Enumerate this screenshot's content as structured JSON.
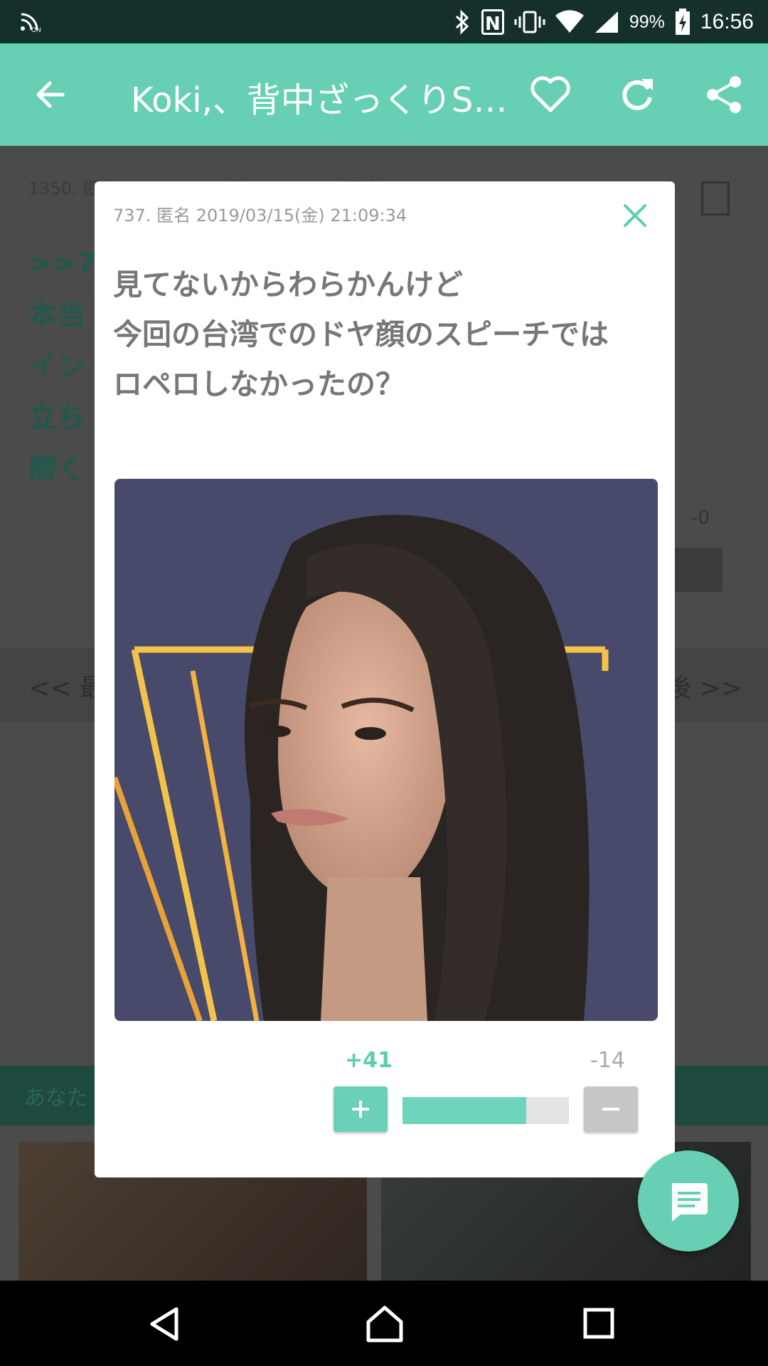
{
  "status_bar": {
    "nfc_label": "N",
    "battery_percent": "99%",
    "time": "16:56",
    "icons": [
      "wifi-calling-icon",
      "bluetooth-icon",
      "nfc-icon",
      "vibrate-icon",
      "wifi-icon",
      "signal-icon",
      "battery-icon"
    ]
  },
  "app_bar": {
    "title": "Koki,、背中ざっくりS…",
    "icons": [
      "back-arrow-icon",
      "heart-icon",
      "refresh-icon",
      "share-icon"
    ]
  },
  "background": {
    "meta": "1350. 匿名 2019/03/16(土) 00:00:00 (返信)",
    "lines": [
      ">>737",
      "本当",
      "イン",
      "立ち",
      "磨く"
    ],
    "minus_count": "-0",
    "nav_first": "<<  最",
    "nav_last": "後  >>",
    "banner": "あなた"
  },
  "modal": {
    "meta": "737. 匿名  2019/03/15(金)  21:09:34",
    "body_lines": [
      "見てないからわらかんけど",
      "今回の台湾でのドヤ顔のスピーチでは",
      "ロペロしなかったの？"
    ],
    "plus_count": "+41",
    "minus_count": "-14",
    "plus_label": "+",
    "minus_label": "−",
    "vote_ratio": 0.745
  },
  "colors": {
    "accent": "#66cfb4",
    "status_bar": "#15302a",
    "overlay": "#4a4a4a"
  }
}
